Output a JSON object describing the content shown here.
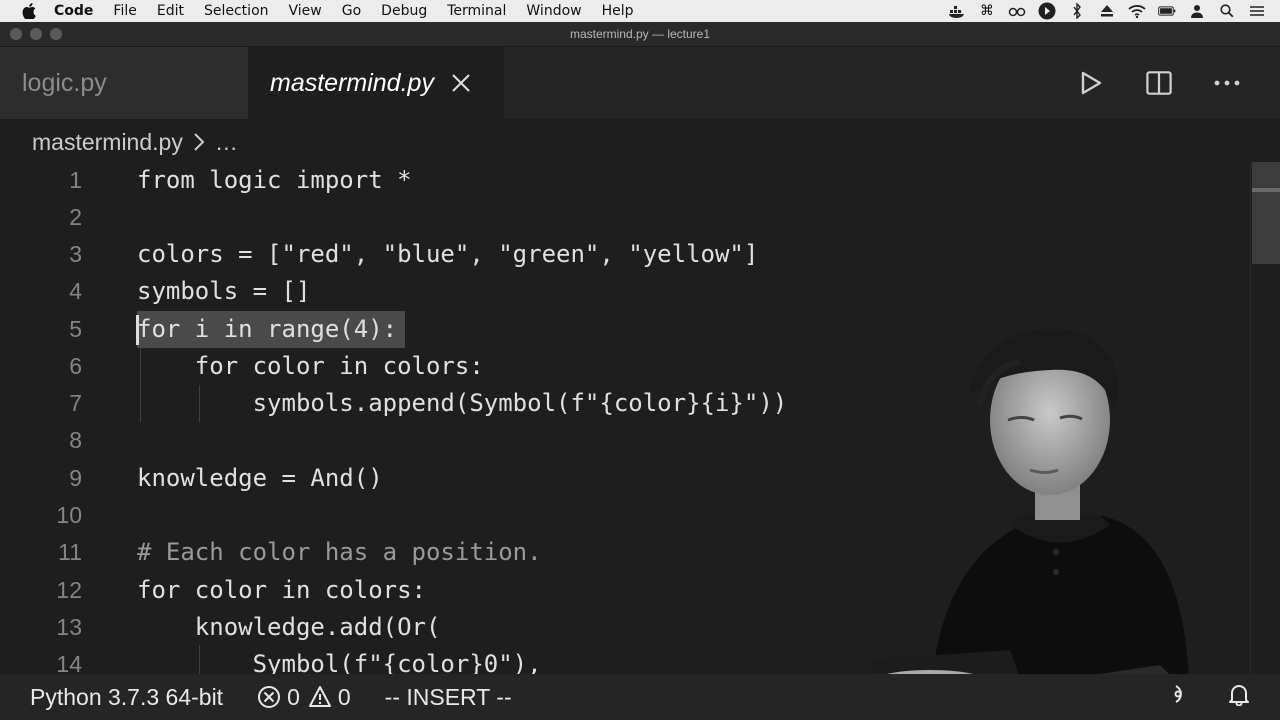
{
  "menubar": {
    "items": [
      "Code",
      "File",
      "Edit",
      "Selection",
      "View",
      "Go",
      "Debug",
      "Terminal",
      "Window",
      "Help"
    ]
  },
  "window": {
    "title": "mastermind.py — lecture1"
  },
  "tabs": [
    {
      "label": "logic.py",
      "active": false
    },
    {
      "label": "mastermind.py",
      "active": true
    }
  ],
  "breadcrumb": {
    "file": "mastermind.py",
    "ellipsis": "…"
  },
  "editor": {
    "lines": [
      {
        "num": "1",
        "text": "from logic import *"
      },
      {
        "num": "2",
        "text": ""
      },
      {
        "num": "3",
        "text": "colors = [\"red\", \"blue\", \"green\", \"yellow\"]"
      },
      {
        "num": "4",
        "text": "symbols = []"
      },
      {
        "num": "5",
        "text": "for i in range(4):"
      },
      {
        "num": "6",
        "text": "    for color in colors:"
      },
      {
        "num": "7",
        "text": "        symbols.append(Symbol(f\"{color}{i}\"))"
      },
      {
        "num": "8",
        "text": ""
      },
      {
        "num": "9",
        "text": "knowledge = And()"
      },
      {
        "num": "10",
        "text": ""
      },
      {
        "num": "11",
        "text": "# Each color has a position."
      },
      {
        "num": "12",
        "text": "for color in colors:"
      },
      {
        "num": "13",
        "text": "    knowledge.add(Or("
      },
      {
        "num": "14",
        "text": "        Symbol(f\"{color}0\"),"
      }
    ],
    "selected_line": "5"
  },
  "statusbar": {
    "interpreter": "Python 3.7.3 64-bit",
    "errors": "0",
    "warnings": "0",
    "mode": "-- INSERT --"
  },
  "colors": {
    "editor_bg": "#1e1e1e",
    "tabbar_bg": "#252526",
    "selection": "#4a4a4a"
  }
}
